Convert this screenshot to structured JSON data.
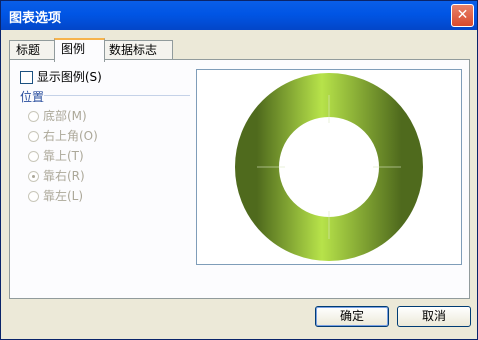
{
  "window": {
    "title": "图表选项"
  },
  "tabs": [
    "标题",
    "图例",
    "数据标志"
  ],
  "legend": {
    "show_label": "显示图例(S)",
    "position_label": "位置",
    "options": [
      "底部(M)",
      "右上角(O)",
      "靠上(T)",
      "靠右(R)",
      "靠左(L)"
    ],
    "selected": "靠右(R)"
  },
  "buttons": {
    "ok": "确定",
    "cancel": "取消"
  },
  "colors": {
    "ring_light": "#b7e34a",
    "ring_dark": "#4f6a1d"
  }
}
